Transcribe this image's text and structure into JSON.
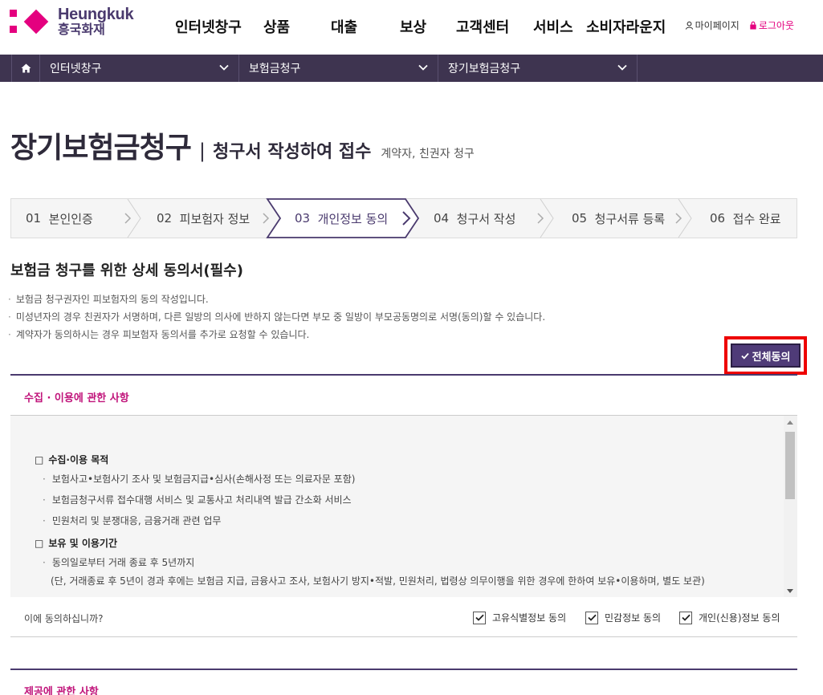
{
  "brand": {
    "name_en": "Heungkuk",
    "name_ko": "흥국화재",
    "color": "#e4007f",
    "color_dark": "#4a3a6e"
  },
  "gnb": [
    {
      "label": "인터넷창구"
    },
    {
      "label": "상품"
    },
    {
      "label": "대출"
    },
    {
      "label": "보상"
    },
    {
      "label": "고객센터"
    },
    {
      "label": "서비스"
    },
    {
      "label": "소비자라운지"
    }
  ],
  "util": {
    "mypage": "마이페이지",
    "logout": "로그아웃"
  },
  "breadcrumb": [
    {
      "label": "인터넷창구"
    },
    {
      "label": "보험금청구"
    },
    {
      "label": "장기보험금청구"
    }
  ],
  "title": {
    "main": "장기보험금청구",
    "separator": "|",
    "sub": "청구서 작성하여 접수",
    "note": "계약자, 친권자 청구"
  },
  "steps": [
    {
      "num": "01",
      "label": "본인인증",
      "active": false
    },
    {
      "num": "02",
      "label": "피보험자 정보",
      "active": false
    },
    {
      "num": "03",
      "label": "개인정보 동의",
      "active": true
    },
    {
      "num": "04",
      "label": "청구서 작성",
      "active": false
    },
    {
      "num": "05",
      "label": "청구서류 등록",
      "active": false
    },
    {
      "num": "06",
      "label": "접수 완료",
      "active": false
    }
  ],
  "section_title": "보험금 청구를 위한 상세 동의서(필수)",
  "notes": [
    "보험금 청구권자인 피보험자의 동의 작성입니다.",
    "미성년자의 경우 친권자가 서명하며, 다른 일방의 의사에 반하지 않는다면 부모 중 일방이 부모공동명의로 서명(동의)할 수 있습니다.",
    "계약자가 동의하시는 경우 피보험자 동의서를 추가로 요청할 수 있습니다."
  ],
  "agree_all_label": "전체동의",
  "collect_section": {
    "title": "수집 · 이용에 관한 사항",
    "heading1": "수집·이용 목적",
    "purposes": [
      "보험사고•보험사기 조사 및 보험금지급•심사(손해사정 또는 의료자문 포함)",
      "보험금청구서류 접수대행 서비스 및 교통사고 처리내역 발급 간소화 서비스",
      "민원처리 및 분쟁대응, 금융거래 관련 업무"
    ],
    "heading2": "보유 및 이용기간",
    "retention": "동의일로부터 거래 종료 후 5년까지",
    "retention_detail": "(단, 거래종료 후 5년이 경과 후에는 보험금 지급, 금융사고 조사, 보험사기 방지•적발, 민원처리, 법령상 의무이행을 위한 경우에 한하여 보유•이용하며, 별도 보관)"
  },
  "agree_row": {
    "question": "이에 동의하십니까?",
    "checkboxes": [
      {
        "label": "고유식별정보 동의",
        "checked": true
      },
      {
        "label": "민감정보 동의",
        "checked": true
      },
      {
        "label": "개인(신용)정보 동의",
        "checked": true
      }
    ]
  },
  "provide_section": {
    "title": "제공에 관한 사항"
  }
}
